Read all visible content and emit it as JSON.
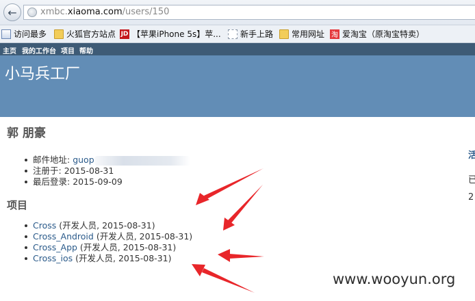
{
  "browser": {
    "url_prefix": "xmbc.",
    "url_domain": "xiaoma.com",
    "url_path": "/users/150",
    "bookmarks": [
      {
        "label": "访问最多",
        "icon": "page-icon"
      },
      {
        "label": "火狐官方站点",
        "icon": "folder-icon"
      },
      {
        "label": "【苹果iPhone 5s】苹...",
        "icon": "jd-icon",
        "icon_text": "JD"
      },
      {
        "label": "新手上路",
        "icon": "blank-page-icon"
      },
      {
        "label": "常用网址",
        "icon": "folder-icon"
      },
      {
        "label": "爱淘宝（原淘宝特卖）",
        "icon": "taobao-icon",
        "icon_text": "淘"
      }
    ]
  },
  "nav": {
    "items": [
      "主页",
      "我的工作台",
      "项目",
      "帮助"
    ]
  },
  "header": {
    "title": "小马兵工厂"
  },
  "user": {
    "name": "郭 朋豪",
    "email_label": "邮件地址: ",
    "email_value": "guop",
    "registered_label": "注册于: ",
    "registered_value": "2015-08-31",
    "last_login_label": "最后登录: ",
    "last_login_value": "2015-09-09"
  },
  "projects": {
    "title": "项目",
    "items": [
      {
        "name": "Cross",
        "detail": " (开发人员, 2015-08-31)"
      },
      {
        "name": "Cross_Android",
        "detail": " (开发人员, 2015-08-31)"
      },
      {
        "name": "Cross_App",
        "detail": " (开发人员, 2015-08-31)"
      },
      {
        "name": "Cross_ios",
        "detail": " (开发人员, 2015-08-31)"
      }
    ]
  },
  "sidebar_clipped": {
    "line1": "活",
    "line2": "已",
    "line3": "2"
  },
  "watermark": "www.wooyun.org",
  "colors": {
    "nav_bg": "#3e5b76",
    "header_bg": "#628db6",
    "link": "#2a5a8a",
    "arrow": "#e8262a"
  }
}
